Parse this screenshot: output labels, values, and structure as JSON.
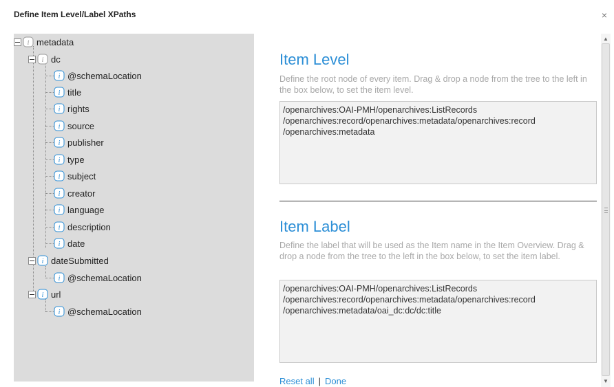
{
  "dialog": {
    "title": "Define Item Level/Label XPaths",
    "close_glyph": "×"
  },
  "tree": {
    "root": {
      "label": "metadata",
      "icon": "info-icon",
      "expanded": true
    },
    "dc": {
      "label": "dc",
      "children": [
        "@schemaLocation",
        "title",
        "rights",
        "source",
        "publisher",
        "type",
        "subject",
        "creator",
        "language",
        "description",
        "date"
      ]
    },
    "dateSubmitted": {
      "label": "dateSubmitted",
      "children": [
        "@schemaLocation"
      ]
    },
    "url": {
      "label": "url",
      "children": [
        "@schemaLocation"
      ]
    }
  },
  "item_level": {
    "title": "Item Level",
    "description": "Define the root node of every item. Drag & drop a node from the tree to the left in the box below, to set the item level.",
    "xpaths": [
      "/openarchives:OAI-PMH/openarchives:ListRecords",
      "/openarchives:record/openarchives:metadata/openarchives:record",
      "/openarchives:metadata"
    ]
  },
  "item_label": {
    "title": "Item Label",
    "description": "Define the label that will be used as the Item name in the Item Overview. Drag & drop a node from the tree to the left in the box below, to set the item label.",
    "xpaths": [
      "/openarchives:OAI-PMH/openarchives:ListRecords",
      "/openarchives:record/openarchives:metadata/openarchives:record",
      "/openarchives:metadata/oai_dc:dc/dc:title"
    ]
  },
  "footer": {
    "reset_label": "Reset all",
    "separator": "|",
    "done_label": "Done"
  },
  "scrollbar": {
    "up_glyph": "▲",
    "down_glyph": "▼"
  },
  "colors": {
    "accent": "#2b8ed6",
    "tree_bg": "#dcdcdc",
    "box_bg": "#f2f2f2"
  }
}
